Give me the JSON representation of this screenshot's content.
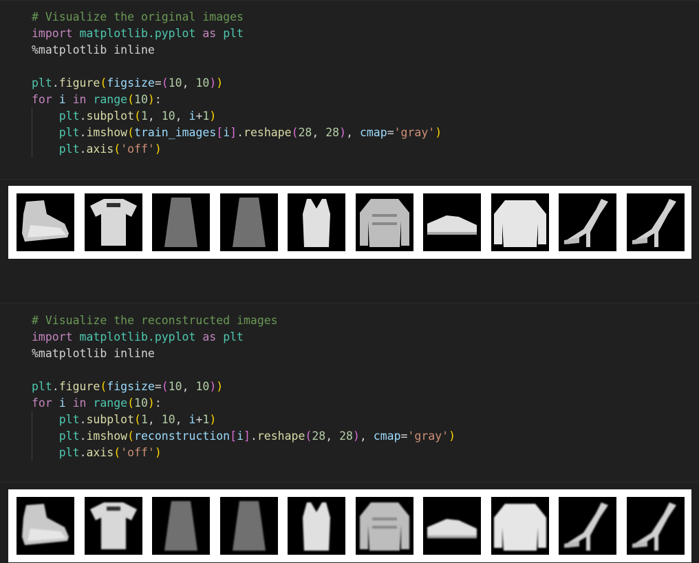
{
  "cells": [
    {
      "lines": [
        [
          {
            "t": "# Visualize the original images",
            "c": "comment"
          }
        ],
        [
          {
            "t": "import",
            "c": "keyword"
          },
          {
            "t": " ",
            "c": "plain"
          },
          {
            "t": "matplotlib.pyplot",
            "c": "module"
          },
          {
            "t": " ",
            "c": "plain"
          },
          {
            "t": "as",
            "c": "keyword"
          },
          {
            "t": " ",
            "c": "plain"
          },
          {
            "t": "plt",
            "c": "module"
          }
        ],
        [
          {
            "t": "%matplotlib inline",
            "c": "plain"
          }
        ],
        [],
        [
          {
            "t": "plt",
            "c": "module"
          },
          {
            "t": ".",
            "c": "plain"
          },
          {
            "t": "figure",
            "c": "func"
          },
          {
            "t": "(",
            "c": "paren1"
          },
          {
            "t": "figsize",
            "c": "param"
          },
          {
            "t": "=",
            "c": "plain"
          },
          {
            "t": "(",
            "c": "paren2"
          },
          {
            "t": "10",
            "c": "number"
          },
          {
            "t": ", ",
            "c": "plain"
          },
          {
            "t": "10",
            "c": "number"
          },
          {
            "t": ")",
            "c": "paren2"
          },
          {
            "t": ")",
            "c": "paren1"
          }
        ],
        [
          {
            "t": "for",
            "c": "control"
          },
          {
            "t": " ",
            "c": "plain"
          },
          {
            "t": "i",
            "c": "var"
          },
          {
            "t": " ",
            "c": "plain"
          },
          {
            "t": "in",
            "c": "control"
          },
          {
            "t": " ",
            "c": "plain"
          },
          {
            "t": "range",
            "c": "module"
          },
          {
            "t": "(",
            "c": "paren1"
          },
          {
            "t": "10",
            "c": "number"
          },
          {
            "t": ")",
            "c": "paren1"
          },
          {
            "t": ":",
            "c": "plain"
          }
        ],
        [
          {
            "t": "    ",
            "c": "plain"
          },
          {
            "t": "plt",
            "c": "module"
          },
          {
            "t": ".",
            "c": "plain"
          },
          {
            "t": "subplot",
            "c": "func"
          },
          {
            "t": "(",
            "c": "paren1"
          },
          {
            "t": "1",
            "c": "number"
          },
          {
            "t": ", ",
            "c": "plain"
          },
          {
            "t": "10",
            "c": "number"
          },
          {
            "t": ", ",
            "c": "plain"
          },
          {
            "t": "i",
            "c": "var"
          },
          {
            "t": "+",
            "c": "plain"
          },
          {
            "t": "1",
            "c": "number"
          },
          {
            "t": ")",
            "c": "paren1"
          }
        ],
        [
          {
            "t": "    ",
            "c": "plain"
          },
          {
            "t": "plt",
            "c": "module"
          },
          {
            "t": ".",
            "c": "plain"
          },
          {
            "t": "imshow",
            "c": "func"
          },
          {
            "t": "(",
            "c": "paren1"
          },
          {
            "t": "train_images",
            "c": "var"
          },
          {
            "t": "[",
            "c": "paren2"
          },
          {
            "t": "i",
            "c": "var"
          },
          {
            "t": "]",
            "c": "paren2"
          },
          {
            "t": ".",
            "c": "plain"
          },
          {
            "t": "reshape",
            "c": "func"
          },
          {
            "t": "(",
            "c": "paren2"
          },
          {
            "t": "28",
            "c": "number"
          },
          {
            "t": ", ",
            "c": "plain"
          },
          {
            "t": "28",
            "c": "number"
          },
          {
            "t": ")",
            "c": "paren2"
          },
          {
            "t": ", ",
            "c": "plain"
          },
          {
            "t": "cmap",
            "c": "param"
          },
          {
            "t": "=",
            "c": "plain"
          },
          {
            "t": "'gray'",
            "c": "string"
          },
          {
            "t": ")",
            "c": "paren1"
          }
        ],
        [
          {
            "t": "    ",
            "c": "plain"
          },
          {
            "t": "plt",
            "c": "module"
          },
          {
            "t": ".",
            "c": "plain"
          },
          {
            "t": "axis",
            "c": "func"
          },
          {
            "t": "(",
            "c": "paren1"
          },
          {
            "t": "'off'",
            "c": "string"
          },
          {
            "t": ")",
            "c": "paren1"
          }
        ]
      ]
    },
    {
      "lines": [
        [
          {
            "t": "# Visualize the reconstructed images",
            "c": "comment"
          }
        ],
        [
          {
            "t": "import",
            "c": "keyword"
          },
          {
            "t": " ",
            "c": "plain"
          },
          {
            "t": "matplotlib.pyplot",
            "c": "module"
          },
          {
            "t": " ",
            "c": "plain"
          },
          {
            "t": "as",
            "c": "keyword"
          },
          {
            "t": " ",
            "c": "plain"
          },
          {
            "t": "plt",
            "c": "module"
          }
        ],
        [
          {
            "t": "%matplotlib inline",
            "c": "plain"
          }
        ],
        [],
        [
          {
            "t": "plt",
            "c": "module"
          },
          {
            "t": ".",
            "c": "plain"
          },
          {
            "t": "figure",
            "c": "func"
          },
          {
            "t": "(",
            "c": "paren1"
          },
          {
            "t": "figsize",
            "c": "param"
          },
          {
            "t": "=",
            "c": "plain"
          },
          {
            "t": "(",
            "c": "paren2"
          },
          {
            "t": "10",
            "c": "number"
          },
          {
            "t": ", ",
            "c": "plain"
          },
          {
            "t": "10",
            "c": "number"
          },
          {
            "t": ")",
            "c": "paren2"
          },
          {
            "t": ")",
            "c": "paren1"
          }
        ],
        [
          {
            "t": "for",
            "c": "control"
          },
          {
            "t": " ",
            "c": "plain"
          },
          {
            "t": "i",
            "c": "var"
          },
          {
            "t": " ",
            "c": "plain"
          },
          {
            "t": "in",
            "c": "control"
          },
          {
            "t": " ",
            "c": "plain"
          },
          {
            "t": "range",
            "c": "module"
          },
          {
            "t": "(",
            "c": "paren1"
          },
          {
            "t": "10",
            "c": "number"
          },
          {
            "t": ")",
            "c": "paren1"
          },
          {
            "t": ":",
            "c": "plain"
          }
        ],
        [
          {
            "t": "    ",
            "c": "plain"
          },
          {
            "t": "plt",
            "c": "module"
          },
          {
            "t": ".",
            "c": "plain"
          },
          {
            "t": "subplot",
            "c": "func"
          },
          {
            "t": "(",
            "c": "paren1"
          },
          {
            "t": "1",
            "c": "number"
          },
          {
            "t": ", ",
            "c": "plain"
          },
          {
            "t": "10",
            "c": "number"
          },
          {
            "t": ", ",
            "c": "plain"
          },
          {
            "t": "i",
            "c": "var"
          },
          {
            "t": "+",
            "c": "plain"
          },
          {
            "t": "1",
            "c": "number"
          },
          {
            "t": ")",
            "c": "paren1"
          }
        ],
        [
          {
            "t": "    ",
            "c": "plain"
          },
          {
            "t": "plt",
            "c": "module"
          },
          {
            "t": ".",
            "c": "plain"
          },
          {
            "t": "imshow",
            "c": "func"
          },
          {
            "t": "(",
            "c": "paren1"
          },
          {
            "t": "reconstruction",
            "c": "var"
          },
          {
            "t": "[",
            "c": "paren2"
          },
          {
            "t": "i",
            "c": "var"
          },
          {
            "t": "]",
            "c": "paren2"
          },
          {
            "t": ".",
            "c": "plain"
          },
          {
            "t": "reshape",
            "c": "func"
          },
          {
            "t": "(",
            "c": "paren2"
          },
          {
            "t": "28",
            "c": "number"
          },
          {
            "t": ", ",
            "c": "plain"
          },
          {
            "t": "28",
            "c": "number"
          },
          {
            "t": ")",
            "c": "paren2"
          },
          {
            "t": ", ",
            "c": "plain"
          },
          {
            "t": "cmap",
            "c": "param"
          },
          {
            "t": "=",
            "c": "plain"
          },
          {
            "t": "'gray'",
            "c": "string"
          },
          {
            "t": ")",
            "c": "paren1"
          }
        ],
        [
          {
            "t": "    ",
            "c": "plain"
          },
          {
            "t": "plt",
            "c": "module"
          },
          {
            "t": ".",
            "c": "plain"
          },
          {
            "t": "axis",
            "c": "func"
          },
          {
            "t": "(",
            "c": "paren1"
          },
          {
            "t": "'off'",
            "c": "string"
          },
          {
            "t": ")",
            "c": "paren1"
          }
        ]
      ]
    }
  ],
  "outputs": [
    {
      "kind": "original",
      "items": [
        "ankle-boot",
        "t-shirt",
        "dress",
        "dress",
        "top",
        "pullover",
        "sneaker",
        "pullover",
        "sandal",
        "sandal"
      ]
    },
    {
      "kind": "reconstructed",
      "items": [
        "ankle-boot",
        "t-shirt",
        "dress",
        "dress",
        "top",
        "pullover",
        "sneaker",
        "pullover",
        "sandal",
        "sandal"
      ]
    }
  ],
  "colors": {
    "editor_bg": "#202020",
    "comment": "#6a9955",
    "keyword": "#c586c0",
    "module": "#4ec9b0",
    "function": "#dcdcaa",
    "parameter": "#9cdcfe",
    "number": "#b5cea8",
    "string": "#ce9178"
  }
}
